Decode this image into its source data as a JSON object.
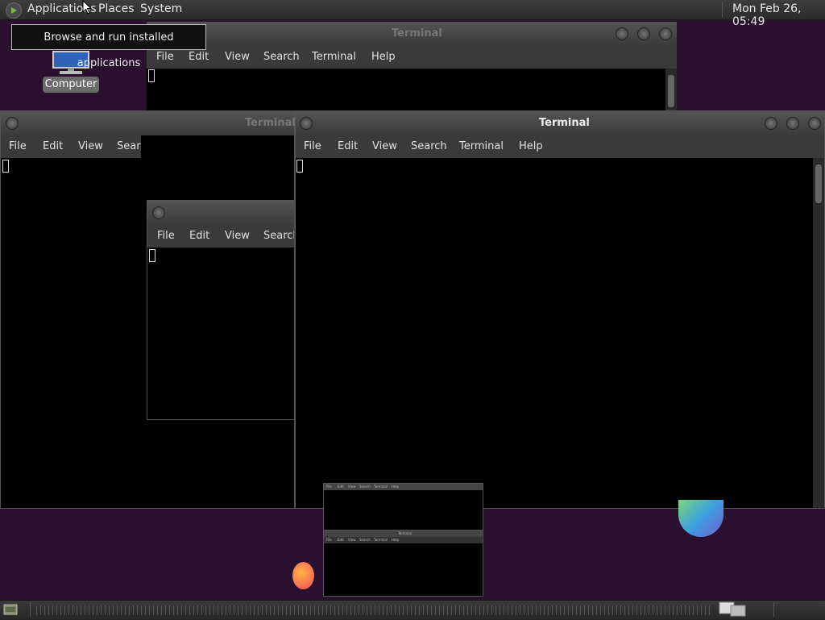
{
  "top_panel": {
    "menus": [
      "Applications",
      "Places",
      "System"
    ],
    "clock": "Mon Feb 26, 05:49"
  },
  "tooltip": "Browse and run installed applications",
  "desktop": {
    "computer_label": "Computer"
  },
  "windows": {
    "back": {
      "title": "Terminal",
      "menus": [
        "File",
        "Edit",
        "View",
        "Search",
        "Terminal",
        "Help"
      ]
    },
    "left": {
      "title": "Terminal",
      "menus": [
        "File",
        "Edit",
        "View",
        "Search"
      ]
    },
    "middle": {
      "menus": [
        "File",
        "Edit",
        "View",
        "Search"
      ]
    },
    "main": {
      "title": "Terminal",
      "menus": [
        "File",
        "Edit",
        "View",
        "Search",
        "Terminal",
        "Help"
      ]
    }
  },
  "thumbnails": {
    "t1": {
      "menus": [
        "File",
        "Edit",
        "View",
        "Search",
        "Terminal",
        "Help"
      ]
    },
    "t2": {
      "title": "Terminal",
      "menus": [
        "File",
        "Edit",
        "View",
        "Search",
        "Terminal",
        "Help"
      ]
    }
  },
  "colors": {
    "desktop_bg": "#2b0f2e",
    "panel": "#333333",
    "terminal_bg": "#000000"
  },
  "icons": [
    "mint-logo-icon",
    "computer-icon",
    "show-desktop-icon",
    "workspace-switcher-icon"
  ]
}
